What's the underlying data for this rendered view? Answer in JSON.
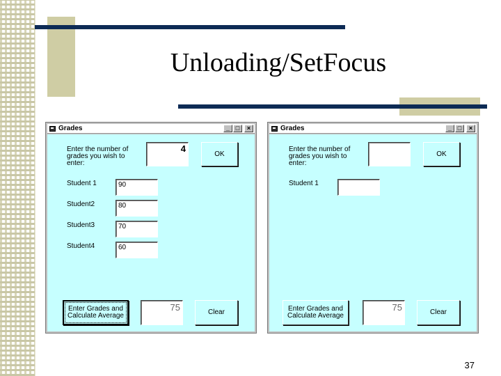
{
  "slide": {
    "title": "Unloading/SetFocus",
    "number": "37"
  },
  "colors": {
    "deco_bar": "#0d2b55",
    "deco_box": "#cfcda4",
    "form_background": "#c6ffff"
  },
  "window_left": {
    "title": "Grades",
    "controls": [
      "_",
      "□",
      "×"
    ],
    "prompt": "Enter the number of grades you wish to enter:",
    "count_value": "4",
    "ok_label": "OK",
    "students": [
      {
        "label": "Student 1",
        "grade": "90"
      },
      {
        "label": "Student2",
        "grade": "80"
      },
      {
        "label": "Student3",
        "grade": "70"
      },
      {
        "label": "Student4",
        "grade": "60"
      }
    ],
    "calc_label": "Enter Grades and Calculate Average",
    "average_value": "75",
    "clear_label": "Clear"
  },
  "window_right": {
    "title": "Grades",
    "controls": [
      "_",
      "□",
      "×"
    ],
    "prompt": "Enter the number of grades you wish to enter:",
    "count_value": "",
    "ok_label": "OK",
    "students": [
      {
        "label": "Student 1",
        "grade": ""
      }
    ],
    "calc_label": "Enter Grades and Calculate Average",
    "average_value": "75",
    "clear_label": "Clear"
  }
}
